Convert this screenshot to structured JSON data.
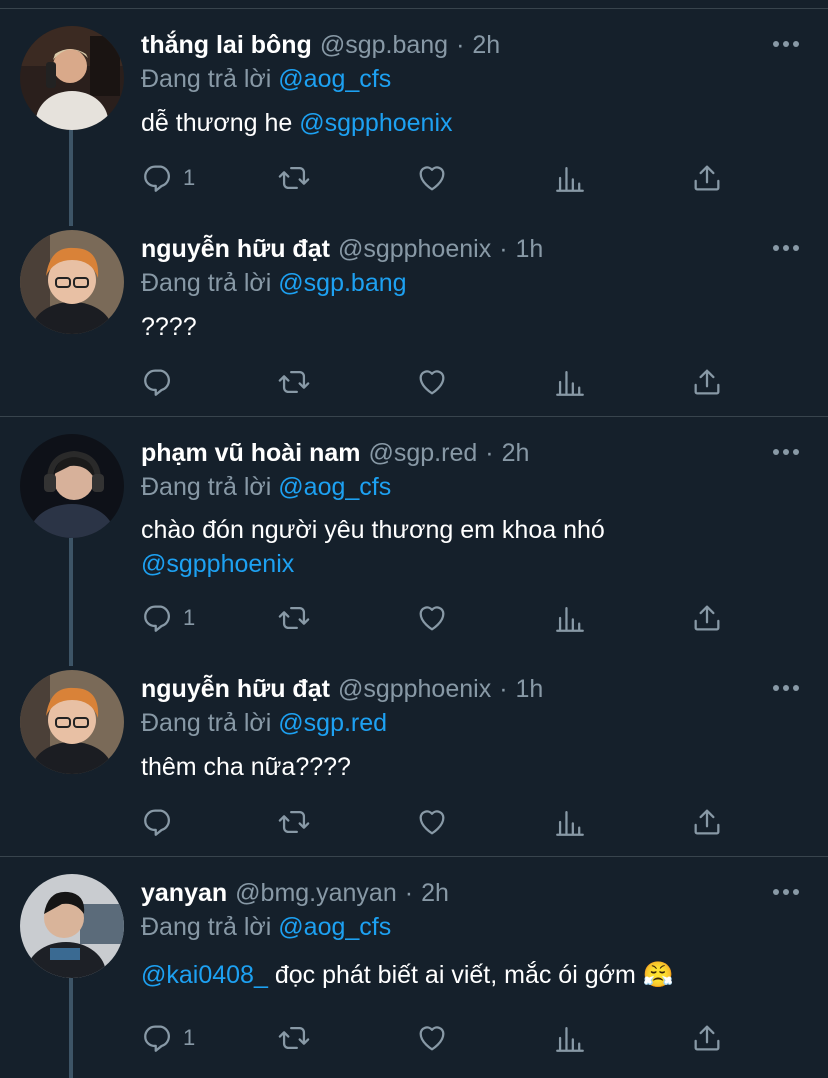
{
  "tweets": [
    {
      "name": "thắng lai bông",
      "handle": "@sgp.bang",
      "time": "2h",
      "replying_prefix": "Đang trả lời",
      "replying_to": "@aog_cfs",
      "text_before": "dễ thương he",
      "mention": "@sgpphoenix",
      "text_after": "",
      "reply_count": "1"
    },
    {
      "name": "nguyễn hữu đạt",
      "handle": "@sgpphoenix",
      "time": "1h",
      "replying_prefix": "Đang trả lời",
      "replying_to": "@sgp.bang",
      "text_before": "????",
      "mention": "",
      "text_after": "",
      "reply_count": ""
    },
    {
      "name": "phạm vũ hoài nam",
      "handle": "@sgp.red",
      "time": "2h",
      "replying_prefix": "Đang trả lời",
      "replying_to": "@aog_cfs",
      "text_before": "chào đón người yêu thương em khoa nhó",
      "mention": "@sgpphoenix",
      "text_after": "",
      "reply_count": "1"
    },
    {
      "name": "nguyễn hữu đạt",
      "handle": "@sgpphoenix",
      "time": "1h",
      "replying_prefix": "Đang trả lời",
      "replying_to": "@sgp.red",
      "text_before": "thêm cha nữa????",
      "mention": "",
      "text_after": "",
      "reply_count": ""
    },
    {
      "name": "yanyan",
      "handle": "@bmg.yanyan",
      "time": "2h",
      "replying_prefix": "Đang trả lời",
      "replying_to": "@aog_cfs",
      "text_before": "",
      "mention": "@kai0408_",
      "text_after": "đọc phát biết ai viết, mắc ói gớm 😤",
      "reply_count": "1"
    }
  ],
  "separator": "·",
  "icons": [
    "reply-icon",
    "retweet-icon",
    "like-icon",
    "analytics-icon",
    "share-icon",
    "more-icon"
  ],
  "colors": {
    "background": "#15202b",
    "text": "#ffffff",
    "muted": "#8899a6",
    "link": "#1da1f2",
    "border": "#38444d",
    "thread": "#3d5466"
  }
}
